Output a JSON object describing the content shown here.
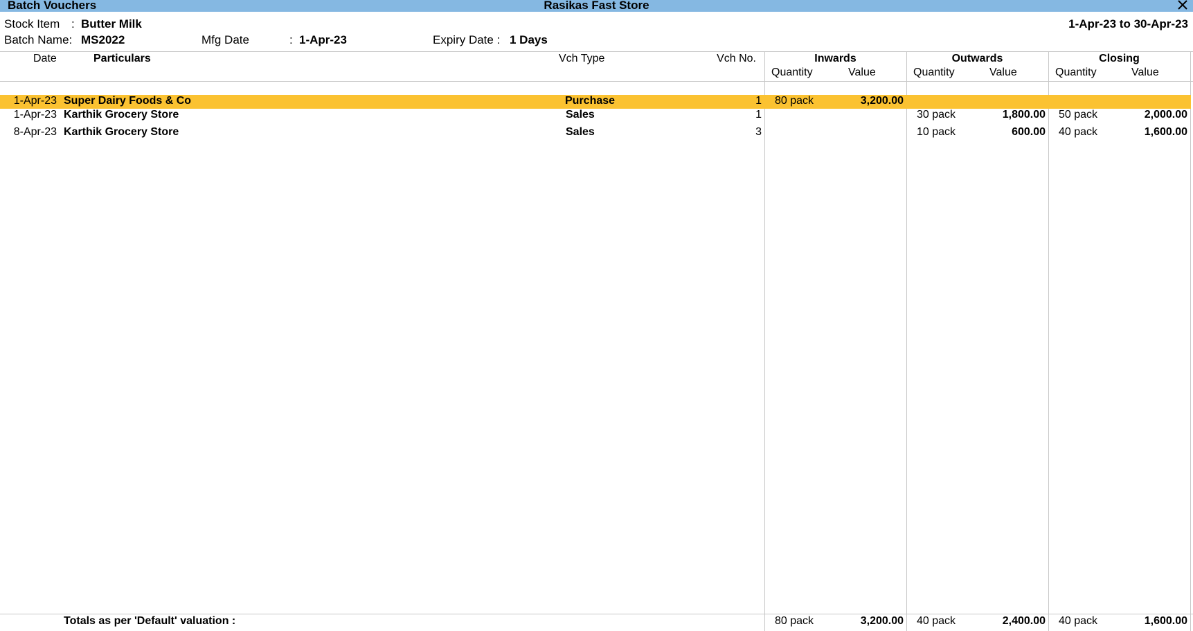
{
  "window": {
    "title": "Batch Vouchers",
    "company": "Rasikas Fast Store",
    "close_icon": "close-icon"
  },
  "header": {
    "stock_item_label": "Stock Item",
    "stock_item_sep": ":",
    "stock_item_value": "Butter Milk",
    "period": "1-Apr-23 to 30-Apr-23",
    "batch_name_label": "Batch Name:",
    "batch_name_value": "MS2022",
    "mfg_date_label": "Mfg Date",
    "mfg_date_sep": ":",
    "mfg_date_value": "1-Apr-23",
    "expiry_label": "Expiry Date :",
    "expiry_value": "1 Days"
  },
  "columns": {
    "date": "Date",
    "particulars": "Particulars",
    "vch_type": "Vch Type",
    "vch_no": "Vch No.",
    "inwards": "Inwards",
    "outwards": "Outwards",
    "closing": "Closing",
    "quantity": "Quantity",
    "value": "Value"
  },
  "rows": [
    {
      "date": "1-Apr-23",
      "particulars": "Super Dairy Foods & Co",
      "vch_type": "Purchase",
      "vch_no": "1",
      "in_qty": "80 pack",
      "in_val": "3,200.00",
      "out_qty": "",
      "out_val": "",
      "cl_qty": "",
      "cl_val": ""
    },
    {
      "date": "1-Apr-23",
      "particulars": "Karthik Grocery Store",
      "vch_type": "Sales",
      "vch_no": "1",
      "in_qty": "",
      "in_val": "",
      "out_qty": "30 pack",
      "out_val": "1,800.00",
      "cl_qty": "50 pack",
      "cl_val": "2,000.00"
    },
    {
      "date": "8-Apr-23",
      "particulars": "Karthik Grocery Store",
      "vch_type": "Sales",
      "vch_no": "3",
      "in_qty": "",
      "in_val": "",
      "out_qty": "10 pack",
      "out_val": "600.00",
      "cl_qty": "40 pack",
      "cl_val": "1,600.00"
    }
  ],
  "totals": {
    "label": "Totals as per 'Default' valuation :",
    "in_qty": "80 pack",
    "in_val": "3,200.00",
    "out_qty": "40 pack",
    "out_val": "2,400.00",
    "cl_qty": "40 pack",
    "cl_val": "1,600.00"
  },
  "colors": {
    "titlebar": "#85B8E2",
    "selected_row": "#FBC231"
  }
}
